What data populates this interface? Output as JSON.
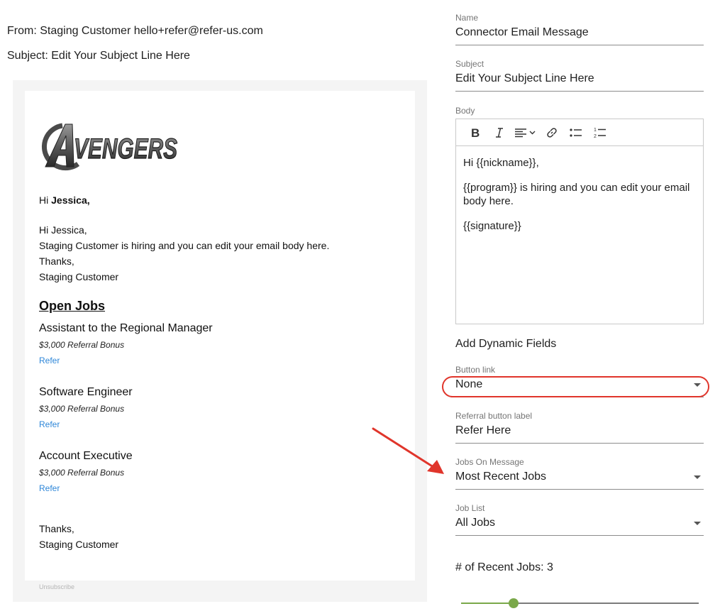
{
  "preview": {
    "from_line": "From: Staging Customer hello+refer@refer-us.com",
    "subject_line": "Subject: Edit Your Subject Line Here",
    "logo_text": "AVENGERS",
    "greeting_prefix": "Hi ",
    "greeting_name": "Jessica,",
    "body_lines": [
      "Hi Jessica,",
      "Staging Customer is hiring and you can edit your email body here.",
      "Thanks,",
      "Staging Customer"
    ],
    "open_jobs_heading": "Open Jobs",
    "jobs": [
      {
        "title": "Assistant to the Regional Manager",
        "bonus": "$3,000 Referral Bonus",
        "refer_label": "Refer"
      },
      {
        "title": "Software Engineer",
        "bonus": "$3,000 Referral Bonus",
        "refer_label": "Refer"
      },
      {
        "title": "Account Executive",
        "bonus": "$3,000 Referral Bonus",
        "refer_label": "Refer"
      }
    ],
    "signoff_lines": [
      "Thanks,",
      "Staging Customer"
    ],
    "unsubscribe": "Unsubscribe"
  },
  "form": {
    "name": {
      "label": "Name",
      "value": "Connector Email Message"
    },
    "subject": {
      "label": "Subject",
      "value": "Edit Your Subject Line Here"
    },
    "body": {
      "label": "Body",
      "toolbar": [
        "bold-icon",
        "italic-icon",
        "align-left-icon",
        "link-icon",
        "bullet-list-icon",
        "numbered-list-icon"
      ],
      "paragraphs": [
        "Hi {{nickname}},",
        "{{program}} is hiring and you can edit your email body here.",
        "{{signature}}"
      ]
    },
    "dynamic_fields_title": "Add Dynamic Fields",
    "button_link": {
      "label": "Button link",
      "value": "None"
    },
    "referral_button_label": {
      "label": "Referral button label",
      "value": "Refer Here"
    },
    "jobs_on_message": {
      "label": "Jobs On Message",
      "value": "Most Recent Jobs"
    },
    "job_list": {
      "label": "Job List",
      "value": "All Jobs"
    },
    "recent_jobs": {
      "label": "# of Recent Jobs: 3",
      "value": 3,
      "fraction": 0.22
    }
  },
  "colors": {
    "accent_green": "#7aa84a",
    "link_blue": "#2d86d8",
    "annotation_red": "#e0352b"
  }
}
